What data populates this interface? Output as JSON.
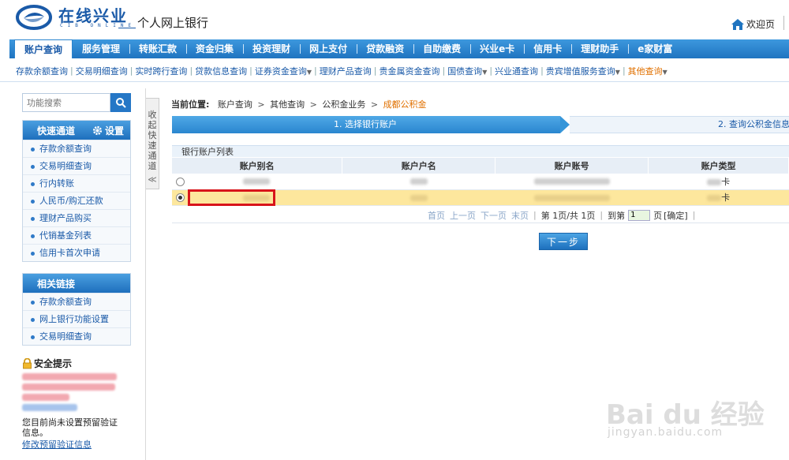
{
  "header": {
    "logo_text": "在线兴业",
    "logo_sub": "CIB ONLINE",
    "bank_title": "个人网上银行",
    "welcome": "欢迎页"
  },
  "nav": {
    "items": [
      {
        "label": "账户查询",
        "active": true
      },
      {
        "label": "服务管理"
      },
      {
        "label": "转账汇款"
      },
      {
        "label": "资金归集"
      },
      {
        "label": "投资理财"
      },
      {
        "label": "网上支付"
      },
      {
        "label": "贷款融资"
      },
      {
        "label": "自助缴费"
      },
      {
        "label": "兴业e卡"
      },
      {
        "label": "信用卡"
      },
      {
        "label": "理财助手"
      },
      {
        "label": "e家财富"
      }
    ]
  },
  "subnav": {
    "items": [
      {
        "label": "存款余额查询"
      },
      {
        "label": "交易明细查询"
      },
      {
        "label": "实时跨行查询"
      },
      {
        "label": "贷款信息查询"
      },
      {
        "label": "证券资金查询",
        "dropdown": true
      },
      {
        "label": "理财产品查询"
      },
      {
        "label": "贵金属资金查询"
      },
      {
        "label": "国债查询",
        "dropdown": true
      },
      {
        "label": "兴业通查询"
      },
      {
        "label": "贵宾增值服务查询",
        "dropdown": true
      },
      {
        "label": "其他查询",
        "dropdown": true,
        "current": true
      }
    ]
  },
  "sidebar": {
    "search_placeholder": "功能搜索",
    "quick": {
      "title": "快速通道",
      "settings": "设置",
      "items": [
        "存款余额查询",
        "交易明细查询",
        "行内转账",
        "人民币/购汇还款",
        "理财产品购买",
        "代销基金列表",
        "信用卡首次申请"
      ]
    },
    "links": {
      "title": "相关链接",
      "items": [
        "存款余额查询",
        "网上银行功能设置",
        "交易明细查询"
      ]
    },
    "safety": {
      "title": "安全提示",
      "text": "您目前尚未设置预留验证信息。",
      "link": "修改预留验证信息"
    },
    "collapse_label": "收起快速通道"
  },
  "breadcrumb": {
    "label": "当前位置:",
    "items": [
      "账户查询",
      "其他查询",
      "公积金业务"
    ],
    "current": "成都公积金"
  },
  "steps": {
    "step1": "1. 选择银行账户",
    "step2": "2. 查询公积金信息"
  },
  "table": {
    "title": "银行账户列表",
    "columns": [
      "账户别名",
      "账户户名",
      "账户账号",
      "账户类型"
    ],
    "rows": [
      {
        "type_suffix": "卡",
        "selected": false
      },
      {
        "type_suffix": "卡",
        "selected": true
      }
    ]
  },
  "pager": {
    "first": "首页",
    "prev": "上一页",
    "next": "下一页",
    "last": "末页",
    "info": "第 1页/共 1页",
    "goto": "到第",
    "page_value": "1",
    "page_unit": "页",
    "confirm": "[确定]"
  },
  "next_button": "下一步",
  "watermark": {
    "logo": "Bai du 经验",
    "url": "jingyan.baidu.com"
  }
}
